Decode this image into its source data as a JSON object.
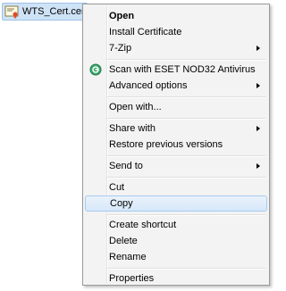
{
  "file": {
    "name": "WTS_Cert.cer",
    "icon": "certificate-file-icon"
  },
  "menu": {
    "items": [
      {
        "label": "Open",
        "bold": true
      },
      {
        "label": "Install Certificate"
      },
      {
        "label": "7-Zip",
        "submenu": true
      },
      {
        "label": "Scan with ESET NOD32 Antivirus",
        "icon": "eset-antivirus-icon"
      },
      {
        "label": "Advanced options",
        "submenu": true
      },
      {
        "label": "Open with..."
      },
      {
        "label": "Share with",
        "submenu": true
      },
      {
        "label": "Restore previous versions"
      },
      {
        "label": "Send to",
        "submenu": true
      },
      {
        "label": "Cut"
      },
      {
        "label": "Copy",
        "highlighted": true
      },
      {
        "label": "Create shortcut"
      },
      {
        "label": "Delete"
      },
      {
        "label": "Rename"
      },
      {
        "label": "Properties"
      }
    ]
  },
  "colors": {
    "highlight_border": "#a8cbed",
    "menu_background": "#f3f3f3",
    "file_selection": "#cfe3f7"
  }
}
